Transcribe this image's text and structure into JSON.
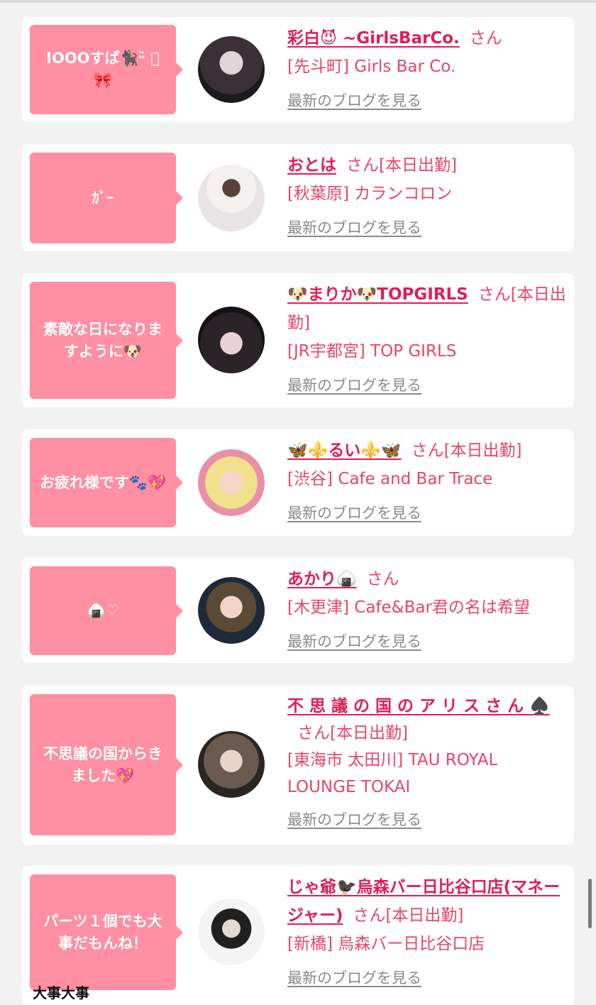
{
  "cards": [
    {
      "message": "IOOOすぱ🐈‍⬛ᵕ̈ ⃝🎀",
      "name": "彩白😈 ~GirlsBarCo.",
      "suffix": "さん",
      "shop": "[先斗町] Girls Bar Co.",
      "blog_link": "最新のブログを見る"
    },
    {
      "message": "ｶﾞｰ",
      "name": "おとは",
      "suffix": "さん[本日出勤]",
      "shop": "[秋葉原] カランコロン",
      "blog_link": "最新のブログを見る"
    },
    {
      "message": "素敵な日になりますように🐶",
      "name": "🐶まりか🐶TOPGIRLS",
      "suffix": "さん[本日出勤]",
      "shop": "[JR宇都宮] TOP GIRLS",
      "blog_link": "最新のブログを見る"
    },
    {
      "message": "お疲れ様です🐾💖",
      "name": "🦋⚜️るい⚜️🦋",
      "suffix": "さん[本日出勤]",
      "shop": "[渋谷] Cafe and Bar Trace",
      "blog_link": "最新のブログを見る"
    },
    {
      "message": "🍙♡",
      "name": "あかり🍙",
      "suffix": "さん",
      "shop": "[木更津] Cafe&Bar君の名は希望",
      "blog_link": "最新のブログを見る"
    },
    {
      "message": "不思議の国からきました💖",
      "name": "不 思 議 の 国 の ア リ ス さ ん ♠️",
      "suffix": "さん[本日出勤]",
      "shop": "[東海市 太田川] TAU ROYAL LOUNGE TOKAI",
      "blog_link": "最新のブログを見る"
    },
    {
      "message": "パーツ１個でも大事だもんね！",
      "name": "じゃ爺🐦‍⬛烏森バー日比谷口店(マネージャー)",
      "suffix": "さん[本日出勤]",
      "shop": "[新橋] 烏森バー日比谷口店",
      "blog_link": "最新のブログを見る"
    }
  ],
  "overlay_caption": "大事大事",
  "colors": {
    "bubble": "#ff8fa3",
    "name": "#e01e56",
    "text": "#e8456a",
    "link": "#8a8a8a"
  }
}
